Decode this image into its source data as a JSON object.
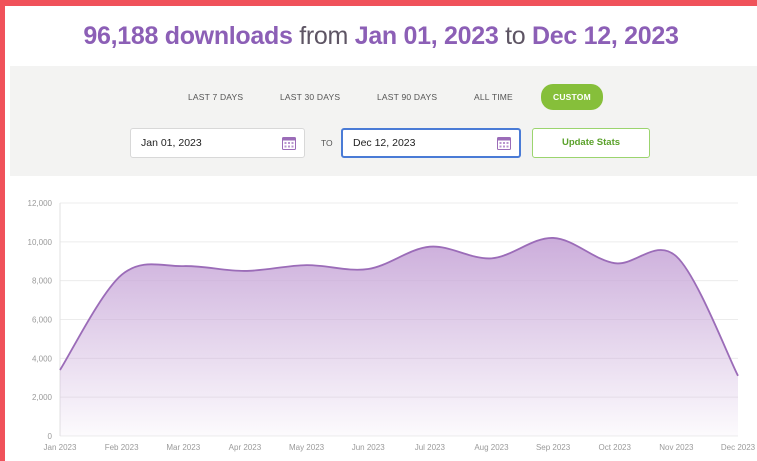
{
  "headline": {
    "count_text": "96,188 downloads",
    "from_word": "from",
    "from_date": "Jan 01, 2023",
    "to_word": "to",
    "to_date": "Dec 12, 2023"
  },
  "range_tabs": [
    "LAST 7 DAYS",
    "LAST 30 DAYS",
    "LAST 90 DAYS",
    "ALL TIME",
    "CUSTOM"
  ],
  "active_tab": "CUSTOM",
  "date_form": {
    "start_value": "Jan 01, 2023",
    "to_label": "TO",
    "end_value": "Dec 12, 2023",
    "update_label": "Update Stats"
  },
  "colors": {
    "accent_purple": "#8c5fb6",
    "line": "#9b6cb8",
    "fill_top": "#c9a9d9",
    "tab_active": "#86bf3a",
    "border": "#f0525a"
  },
  "chart_data": {
    "type": "area",
    "categories": [
      "Jan 2023",
      "Feb 2023",
      "Mar 2023",
      "Apr 2023",
      "May 2023",
      "Jun 2023",
      "Jul 2023",
      "Aug 2023",
      "Sep 2023",
      "Oct 2023",
      "Nov 2023",
      "Dec 2023"
    ],
    "series": [
      {
        "values": [
          3400,
          8300,
          8750,
          8500,
          8800,
          8600,
          9750,
          9150,
          10200,
          8900,
          9250,
          3100
        ]
      }
    ],
    "yticks": [
      "0",
      "2,000",
      "4,000",
      "6,000",
      "8,000",
      "10,000",
      "12,000"
    ],
    "ylim": [
      0,
      12000
    ],
    "grid": true,
    "legend": false
  }
}
